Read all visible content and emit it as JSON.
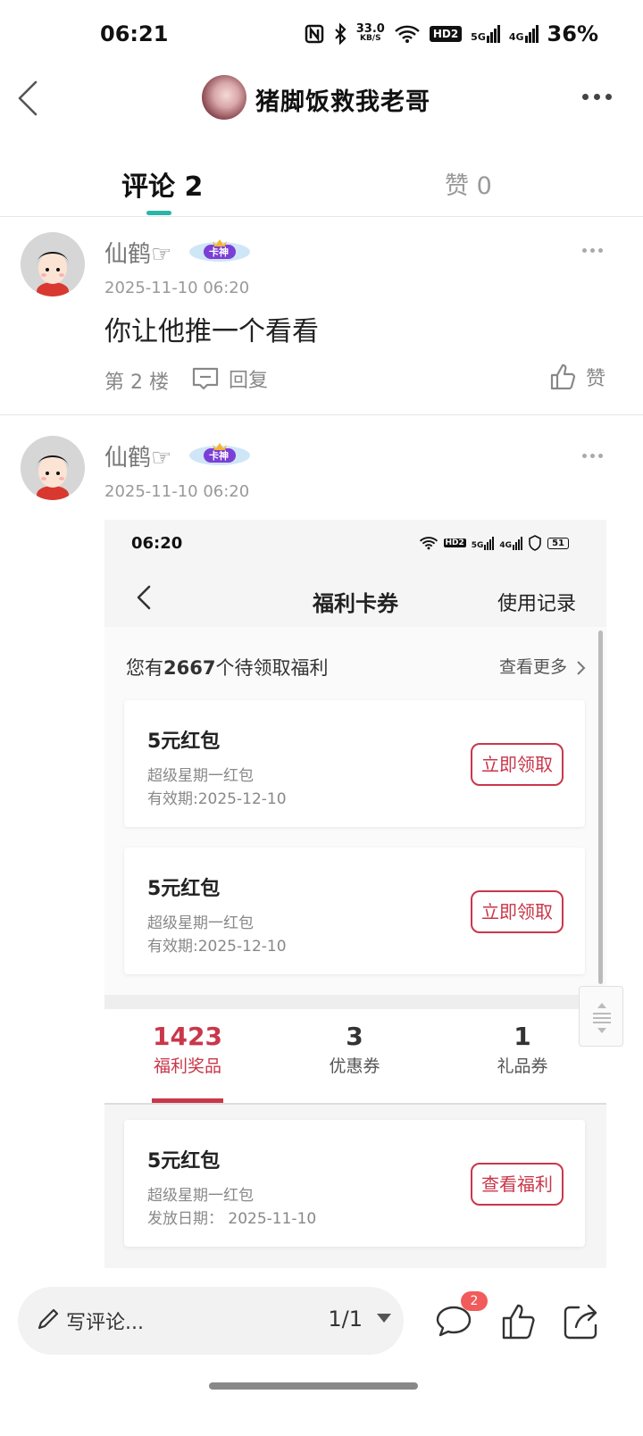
{
  "status_bar": {
    "time": "06:21",
    "network_speed": "33.0",
    "network_speed_unit": "KB/S",
    "hd_label": "HD2",
    "signal_5g": "5G",
    "signal_4g": "4G",
    "battery": "36%"
  },
  "header": {
    "title": "猪脚饭救我老哥"
  },
  "tabs": {
    "comments_label": "评论 2",
    "likes_label": "赞 0"
  },
  "comments": [
    {
      "user": "仙鹤☞",
      "badge_text": "卡神",
      "time": "2025-11-10 06:20",
      "text": "你让他推一个看看",
      "floor": "第 2 楼",
      "reply_label": "回复",
      "like_label": "赞"
    },
    {
      "user": "仙鹤☞",
      "badge_text": "卡神",
      "time": "2025-11-10 06:20"
    }
  ],
  "embedded_screenshot": {
    "status_time": "06:20",
    "hd_label": "HD2",
    "signal_5g": "5G",
    "signal_4g": "4G",
    "battery": "51",
    "title": "福利卡券",
    "record_label": "使用记录",
    "pending_prefix": "您有",
    "pending_count": "2667",
    "pending_suffix": "个待领取福利",
    "view_more": "查看更多",
    "cards": [
      {
        "title": "5元红包",
        "subtitle": "超级星期一红包",
        "date": "有效期:2025-12-10",
        "button": "立即领取"
      },
      {
        "title": "5元红包",
        "subtitle": "超级星期一红包",
        "date": "有效期:2025-12-10",
        "button": "立即领取"
      }
    ],
    "stats": [
      {
        "value": "1423",
        "label": "福利奖品"
      },
      {
        "value": "3",
        "label": "优惠券"
      },
      {
        "value": "1",
        "label": "礼品券"
      }
    ],
    "bottom_card": {
      "title": "5元红包",
      "subtitle": "超级星期一红包",
      "date": "发放日期： 2025-11-10",
      "button": "查看福利"
    }
  },
  "bottom_bar": {
    "input_placeholder": "写评论...",
    "page_indicator": "1/1",
    "comment_count": "2"
  },
  "colors": {
    "accent_teal": "#2bb5a6",
    "accent_red": "#c9374a",
    "badge_red": "#f25b5b"
  }
}
